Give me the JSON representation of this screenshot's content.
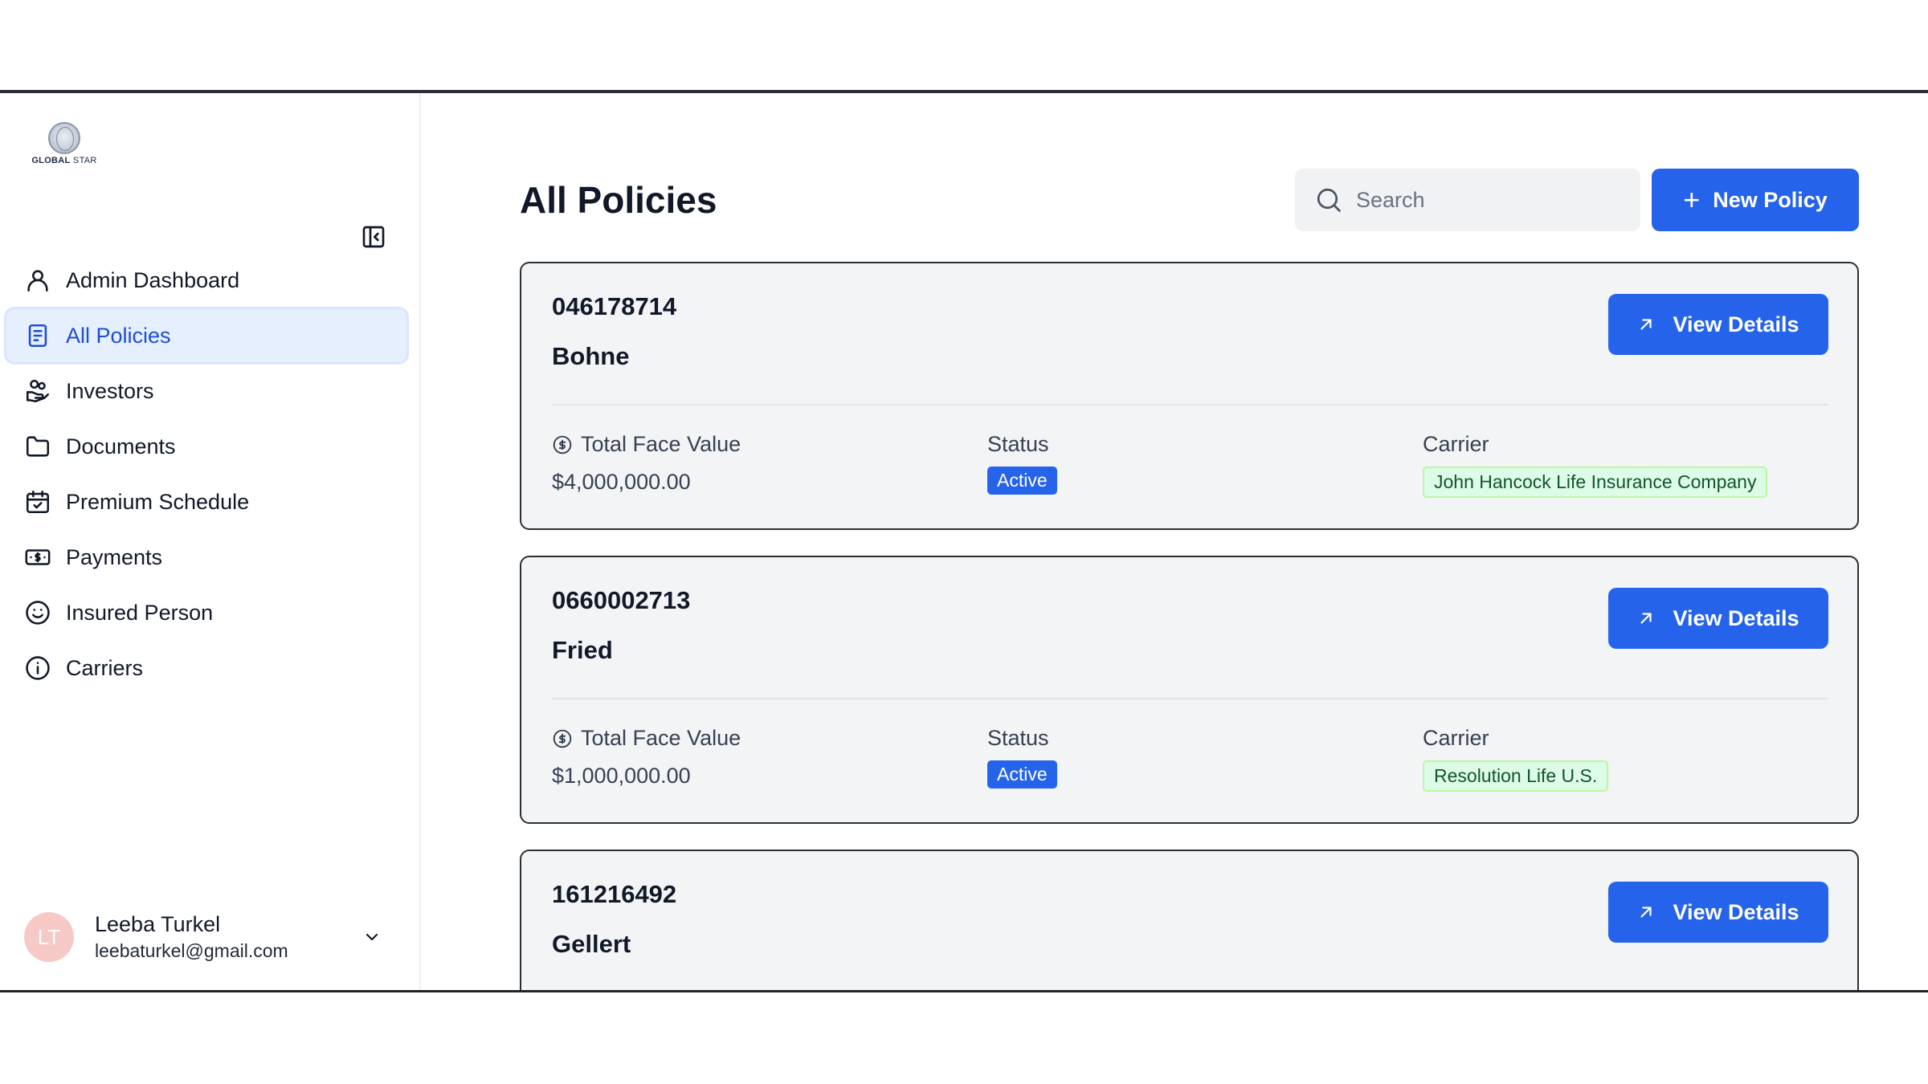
{
  "brand": {
    "logo_text_bold": "GLOBAL",
    "logo_text_light": " STAR"
  },
  "sidebar": {
    "items": [
      {
        "label": "Admin Dashboard",
        "icon": "user-icon"
      },
      {
        "label": "All Policies",
        "icon": "document-icon"
      },
      {
        "label": "Investors",
        "icon": "hand-coins-icon"
      },
      {
        "label": "Documents",
        "icon": "folder-icon"
      },
      {
        "label": "Premium Schedule",
        "icon": "calendar-check-icon"
      },
      {
        "label": "Payments",
        "icon": "banknote-icon"
      },
      {
        "label": "Insured Person",
        "icon": "smile-icon"
      },
      {
        "label": "Carriers",
        "icon": "info-icon"
      }
    ],
    "active_index": 1
  },
  "user": {
    "initials": "LT",
    "name": "Leeba Turkel",
    "email": "leebaturkel@gmail.com"
  },
  "main": {
    "title": "All Policies",
    "search": {
      "placeholder": "Search",
      "value": ""
    },
    "new_button_label": "New Policy"
  },
  "labels": {
    "total_face_value": "Total Face Value",
    "status": "Status",
    "carrier": "Carrier",
    "view_details": "View Details"
  },
  "policies": [
    {
      "id": "046178714",
      "name": "Bohne",
      "face_value": "$4,000,000.00",
      "status": "Active",
      "carrier": "John Hancock Life Insurance Company"
    },
    {
      "id": "0660002713",
      "name": "Fried",
      "face_value": "$1,000,000.00",
      "status": "Active",
      "carrier": "Resolution Life U.S."
    },
    {
      "id": "161216492",
      "name": "Gellert"
    }
  ],
  "colors": {
    "accent": "#2563eb",
    "active_nav_bg": "#e6effd",
    "carrier_badge_bg": "#dcfce7",
    "avatar_bg": "#f6c8c6"
  }
}
